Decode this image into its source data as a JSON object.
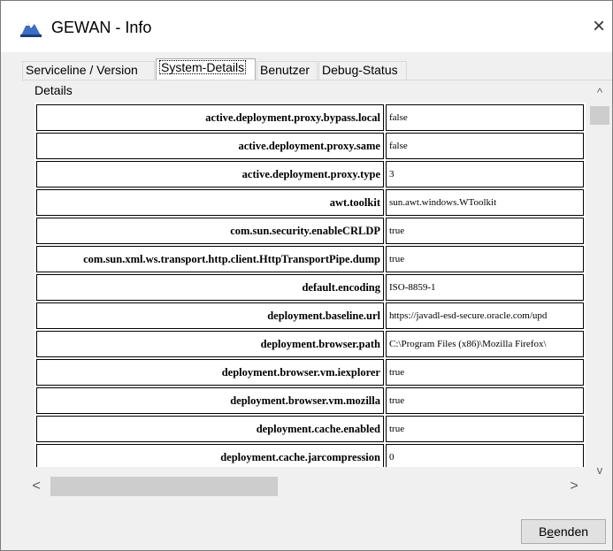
{
  "window": {
    "title": "GEWAN - Info",
    "close_label": "×"
  },
  "tabs": [
    {
      "label": "Serviceline / Version",
      "active": false
    },
    {
      "label": "System-Details",
      "active": true
    },
    {
      "label": "Benutzer",
      "active": false
    },
    {
      "label": "Debug-Status",
      "active": false
    }
  ],
  "details": {
    "label": "Details",
    "rows": [
      {
        "key": "active.deployment.proxy.bypass.local",
        "value": "false"
      },
      {
        "key": "active.deployment.proxy.same",
        "value": "false"
      },
      {
        "key": "active.deployment.proxy.type",
        "value": "3"
      },
      {
        "key": "awt.toolkit",
        "value": "sun.awt.windows.WToolkit"
      },
      {
        "key": "com.sun.security.enableCRLDP",
        "value": "true"
      },
      {
        "key": "com.sun.xml.ws.transport.http.client.HttpTransportPipe.dump",
        "value": "true"
      },
      {
        "key": "default.encoding",
        "value": "ISO-8859-1"
      },
      {
        "key": "deployment.baseline.url",
        "value": "https://javadl-esd-secure.oracle.com/upd"
      },
      {
        "key": "deployment.browser.path",
        "value": "C:\\Program Files (x86)\\Mozilla Firefox\\"
      },
      {
        "key": "deployment.browser.vm.iexplorer",
        "value": "true"
      },
      {
        "key": "deployment.browser.vm.mozilla",
        "value": "true"
      },
      {
        "key": "deployment.cache.enabled",
        "value": "true"
      },
      {
        "key": "deployment.cache.jarcompression",
        "value": "0"
      }
    ]
  },
  "scrollbars": {
    "up": "^",
    "down": "v",
    "left": "<",
    "right": ">"
  },
  "buttons": {
    "end_pre": "B",
    "end_mnemonic": "e",
    "end_post": "enden"
  },
  "colors": {
    "panel_bg": "#f0f0f0",
    "button_bg": "#e1e1e1",
    "scroll_thumb": "#cdcdcd"
  }
}
